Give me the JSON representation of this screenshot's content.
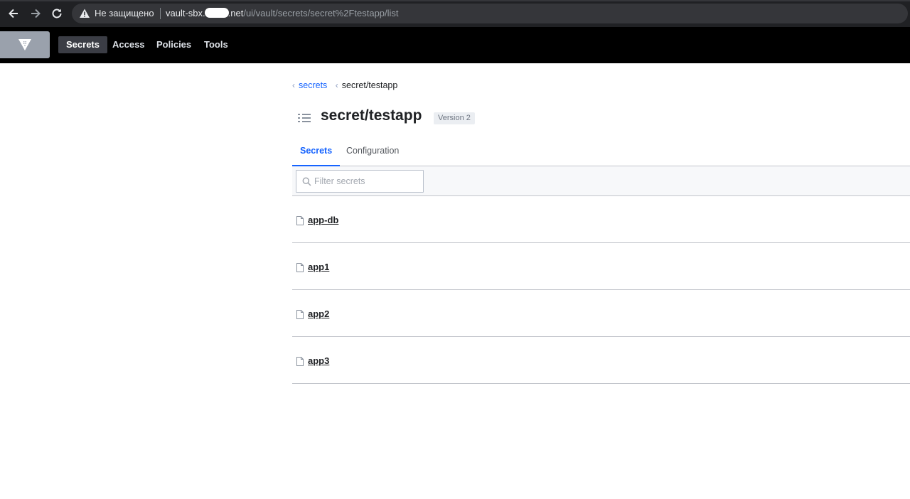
{
  "browser": {
    "security_warning": "Не защищено",
    "url_host_start": "vault-sbx.",
    "url_host_end": ".net",
    "url_path": "/ui/vault/secrets/secret%2Ftestapp/list"
  },
  "header": {
    "logo": "vault-logo-icon",
    "nav": {
      "secrets": "Secrets",
      "access": "Access",
      "policies": "Policies",
      "tools": "Tools"
    }
  },
  "breadcrumb": {
    "root": "secrets",
    "current": "secret/testapp"
  },
  "page": {
    "title": "secret/testapp",
    "version": "Version 2"
  },
  "tabs": {
    "secrets": "Secrets",
    "configuration": "Configuration"
  },
  "filter": {
    "placeholder": "Filter secrets",
    "value": ""
  },
  "secrets": [
    {
      "name": "app-db"
    },
    {
      "name": "app1"
    },
    {
      "name": "app2"
    },
    {
      "name": "app3"
    }
  ],
  "colors": {
    "accent": "#1563ff",
    "nav_bg": "#000000"
  }
}
